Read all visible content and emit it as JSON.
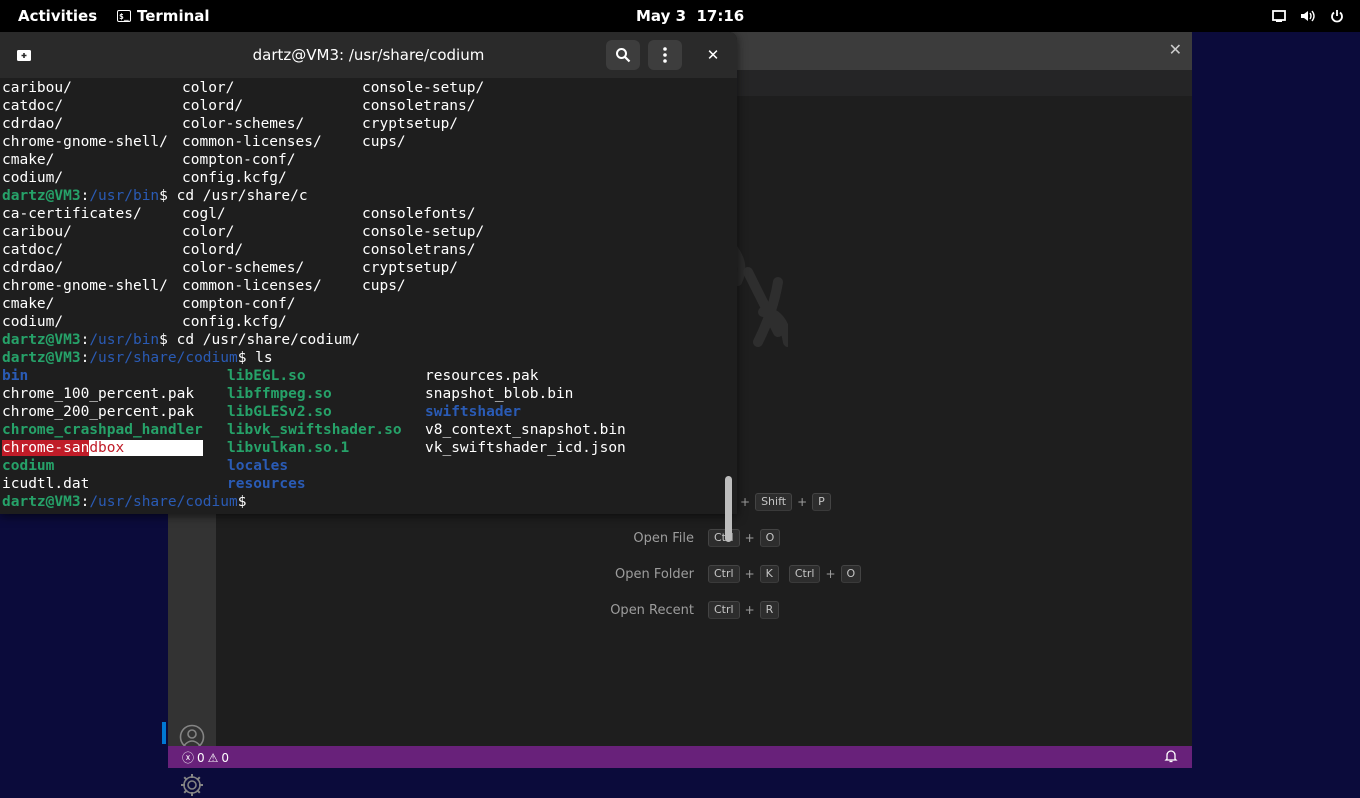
{
  "topbar": {
    "activities": "Activities",
    "app_name": "Terminal",
    "app_icon_glyph": "$_",
    "date": "May 3",
    "time": "17:16",
    "tray_icons": [
      "display-icon",
      "volume-icon",
      "power-icon"
    ]
  },
  "terminal": {
    "title": "dartz@VM3: /usr/share/codium",
    "lines": [
      {
        "cells": [
          {
            "t": "caribou/",
            "c": ""
          },
          {
            "t": "color/",
            "c": "",
            "col": 1
          },
          {
            "t": "console-setup/",
            "c": "",
            "col": 2
          }
        ]
      },
      {
        "cells": [
          {
            "t": "catdoc/",
            "c": ""
          },
          {
            "t": "colord/",
            "c": "",
            "col": 1
          },
          {
            "t": "consoletrans/",
            "c": "",
            "col": 2
          }
        ]
      },
      {
        "cells": [
          {
            "t": "cdrdao/",
            "c": ""
          },
          {
            "t": "color-schemes/",
            "c": "",
            "col": 1
          },
          {
            "t": "cryptsetup/",
            "c": "",
            "col": 2
          }
        ]
      },
      {
        "cells": [
          {
            "t": "chrome-gnome-shell/",
            "c": ""
          },
          {
            "t": "common-licenses/",
            "c": "",
            "col": 1
          },
          {
            "t": "cups/",
            "c": "",
            "col": 2
          }
        ]
      },
      {
        "cells": [
          {
            "t": "cmake/",
            "c": ""
          },
          {
            "t": "compton-conf/",
            "c": "",
            "col": 1
          }
        ]
      },
      {
        "cells": [
          {
            "t": "codium/",
            "c": ""
          },
          {
            "t": "config.kcfg/",
            "c": "",
            "col": 1
          }
        ]
      },
      {
        "prompt": {
          "user": "dartz@VM3",
          "sep": ":",
          "path": "/usr/bin",
          "cmd": "$ cd /usr/share/c"
        }
      },
      {
        "cells": [
          {
            "t": "ca-certificates/",
            "c": ""
          },
          {
            "t": "cogl/",
            "c": "",
            "col": 1
          },
          {
            "t": "consolefonts/",
            "c": "",
            "col": 2
          }
        ]
      },
      {
        "cells": [
          {
            "t": "caribou/",
            "c": ""
          },
          {
            "t": "color/",
            "c": "",
            "col": 1
          },
          {
            "t": "console-setup/",
            "c": "",
            "col": 2
          }
        ]
      },
      {
        "cells": [
          {
            "t": "catdoc/",
            "c": ""
          },
          {
            "t": "colord/",
            "c": "",
            "col": 1
          },
          {
            "t": "consoletrans/",
            "c": "",
            "col": 2
          }
        ]
      },
      {
        "cells": [
          {
            "t": "cdrdao/",
            "c": ""
          },
          {
            "t": "color-schemes/",
            "c": "",
            "col": 1
          },
          {
            "t": "cryptsetup/",
            "c": "",
            "col": 2
          }
        ]
      },
      {
        "cells": [
          {
            "t": "chrome-gnome-shell/",
            "c": ""
          },
          {
            "t": "common-licenses/",
            "c": "",
            "col": 1
          },
          {
            "t": "cups/",
            "c": "",
            "col": 2
          }
        ]
      },
      {
        "cells": [
          {
            "t": "cmake/",
            "c": ""
          },
          {
            "t": "compton-conf/",
            "c": "",
            "col": 1
          }
        ]
      },
      {
        "cells": [
          {
            "t": "codium/",
            "c": ""
          },
          {
            "t": "config.kcfg/",
            "c": "",
            "col": 1
          }
        ]
      },
      {
        "prompt": {
          "user": "dartz@VM3",
          "sep": ":",
          "path": "/usr/bin",
          "cmd": "$ cd /usr/share/codium/"
        }
      },
      {
        "prompt": {
          "user": "dartz@VM3",
          "sep": ":",
          "path": "/usr/share/codium",
          "cmd": "$ ls"
        }
      },
      {
        "cells": [
          {
            "t": "bin",
            "c": "dir",
            "col": 0
          },
          {
            "t": "libEGL.so",
            "c": "exec",
            "col": 3
          },
          {
            "t": "resources.pak",
            "c": "",
            "col": 4
          }
        ]
      },
      {
        "cells": [
          {
            "t": "chrome_100_percent.pak",
            "c": "",
            "col": 0
          },
          {
            "t": "libffmpeg.so",
            "c": "exec",
            "col": 3
          },
          {
            "t": "snapshot_blob.bin",
            "c": "",
            "col": 4
          }
        ]
      },
      {
        "cells": [
          {
            "t": "chrome_200_percent.pak",
            "c": "",
            "col": 0
          },
          {
            "t": "libGLESv2.so",
            "c": "exec",
            "col": 3
          },
          {
            "t": "swiftshader",
            "c": "dir",
            "col": 4
          }
        ]
      },
      {
        "cells": [
          {
            "t": "chrome_crashpad_handler",
            "c": "exec",
            "col": 0
          },
          {
            "t": "libvk_swiftshader.so",
            "c": "exec",
            "col": 3
          },
          {
            "t": "v8_context_snapshot.bin",
            "c": "",
            "col": 4
          }
        ]
      },
      {
        "cells": [
          {
            "t": "chrome-sandbox",
            "c": "sandbox",
            "col": 0
          },
          {
            "t": "libvulkan.so.1",
            "c": "exec",
            "col": 3
          },
          {
            "t": "vk_swiftshader_icd.json",
            "c": "",
            "col": 4
          }
        ]
      },
      {
        "cells": [
          {
            "t": "codium",
            "c": "exec",
            "col": 0
          },
          {
            "t": "locales",
            "c": "dir",
            "col": 3
          }
        ]
      },
      {
        "cells": [
          {
            "t": "icudtl.dat",
            "c": "",
            "col": 0
          },
          {
            "t": "resources",
            "c": "dir",
            "col": 3
          }
        ]
      },
      {
        "prompt": {
          "user": "dartz@VM3",
          "sep": ":",
          "path": "/usr/share/codium",
          "cmd": "$"
        }
      }
    ]
  },
  "codium": {
    "shortcuts": [
      {
        "label": "",
        "keys": [
          [
            "+ ",
            "Shift"
          ],
          [
            "+ ",
            "P"
          ]
        ],
        "partial": true
      },
      {
        "label": "Open File",
        "keys": [
          [
            "Ctrl"
          ],
          [
            "O"
          ]
        ]
      },
      {
        "label": "Open Folder",
        "keys": [
          [
            "Ctrl"
          ],
          [
            "K"
          ]
        ],
        "keys2": [
          [
            "Ctrl"
          ],
          [
            "O"
          ]
        ]
      },
      {
        "label": "Open Recent",
        "keys": [
          [
            "Ctrl"
          ],
          [
            "R"
          ]
        ]
      }
    ],
    "status": {
      "errors": "0",
      "warnings": "0"
    }
  },
  "colors": {
    "accent_status_bar": "#68217a",
    "prompt_user": "#26a269",
    "prompt_path": "#2a5bb5"
  }
}
